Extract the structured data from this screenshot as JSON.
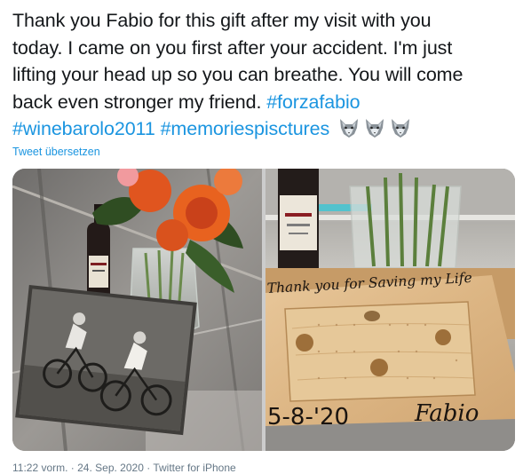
{
  "tweet": {
    "text_lines": [
      "Thank you Fabio for this gift after my visit with you",
      "today.  I came on you first after your accident.  I'm just",
      "lifting your head up so you can breathe.  You will come",
      "back even stronger my friend. "
    ],
    "hashtags": [
      "#forzafabio",
      "#winebarolo2011",
      "#memoriespisctures"
    ],
    "emoji": [
      "wolf-emoji",
      "wolf-emoji",
      "wolf-emoji"
    ],
    "translate_label": "Tweet übersetzen"
  },
  "media": {
    "left_photo": {
      "subject": "flowers-wine-cycling-photo"
    },
    "right_photo": {
      "subject": "wine-holder-board",
      "board_message": "Thank you for Saving my Life",
      "board_signature_date": "5-8-'20",
      "board_signature_name": "Fabio"
    }
  },
  "footer": {
    "timestamp": "11:22 vorm. · 24. Sep. 2020 · Twitter for iPhone"
  },
  "colors": {
    "link": "#1b95e0",
    "text": "#14171a",
    "muted": "#657786"
  }
}
